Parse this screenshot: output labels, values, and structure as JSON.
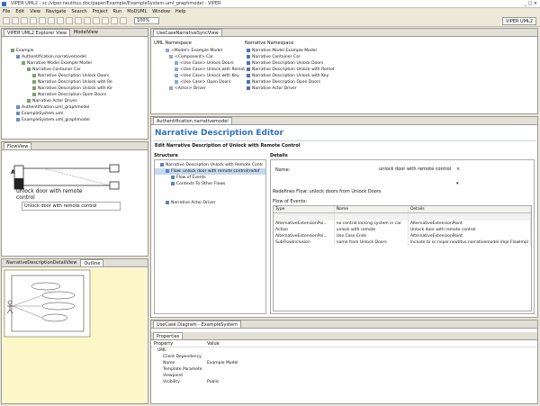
{
  "window": {
    "title": "VIPER UML2 - sc:/viper.neutitus.doc/paper/Example/ExampleSystem.uml_graphmodel - VIPER"
  },
  "menu": [
    "File",
    "Edit",
    "View",
    "Navigate",
    "Search",
    "Project",
    "Run",
    "MoDUML",
    "Window",
    "Help"
  ],
  "toolbar": {
    "zoom": "100%",
    "perspective": "VIPER UML2"
  },
  "explorer": {
    "tabs": [
      "VIPER UML2 Explorer View",
      "ModelView"
    ],
    "items": [
      {
        "label": "Example",
        "indent": 6
      },
      {
        "label": "Authentification.narrativemodel",
        "indent": 12
      },
      {
        "label": "Narrative Model Example Model",
        "indent": 18
      },
      {
        "label": "Narrative Container Car",
        "indent": 24
      },
      {
        "label": "Narrative Description Unlock Doors",
        "indent": 30
      },
      {
        "label": "Narrative Description Unlock with Re",
        "indent": 30
      },
      {
        "label": "Narrative Description Unlock with Ke",
        "indent": 30
      },
      {
        "label": "Narrative Description Open Doors",
        "indent": 30
      },
      {
        "label": "Narrative Actor Driver",
        "indent": 24
      },
      {
        "label": "Authentification.uml_graphmodel",
        "indent": 12
      },
      {
        "label": "ExampleSystem.uml",
        "indent": 12
      },
      {
        "label": "ExampleSystem.uml_graphmodel",
        "indent": 12
      }
    ]
  },
  "flowview": {
    "tab": "FlowView",
    "node_label": "A",
    "action": "unlock door with remote control",
    "note": "Unlock door with remote control"
  },
  "outline": {
    "tabs": [
      "NarrativeDescriptionDetailView",
      "Outline"
    ]
  },
  "sync": {
    "tab": "UseCaseNarrativeSyncView",
    "left_header": "UML Namespace",
    "left_items": [
      "<Model> Example Model",
      "<Component> Car",
      "<Use Case> Unlock Doors",
      "<Use Case> Unlock with Remot",
      "<Use Case> Unlock with Key",
      "<Use Case> Open Doors",
      "<Actor> Driver"
    ],
    "right_header": "Narrative Namespace",
    "right_items": [
      "Narrative Model Example Model",
      "Narrative Container Car",
      "Narrative Description Unlock Doors",
      "Narrative Description Unlock with Remot",
      "Narrative Description Unlock with Key",
      "Narrative Description Open Doors",
      "Narrative Actor Driver"
    ]
  },
  "editor": {
    "tab": "Authentification.narrativemodel",
    "title": "Narrative Description Editor",
    "subtitle": "Edit Narrative Description of Unlock with Remote Control",
    "structure_header": "Structure",
    "structure_items": [
      "Narrative Description Unlock with Remote Contr",
      "Flow: unlock door with remote control(redef",
      "Flow of Events",
      "Contexts To Other Flows",
      "",
      "",
      "Narrative Actor Driver"
    ],
    "details_header": "Details",
    "name_label": "Name:",
    "name_value": "unlock door with remote control",
    "redefines": "Redefines Flow: unlock doors from Unlock Doors",
    "flow_label": "Flow of Events:",
    "columns": [
      "Type",
      "Name",
      "Details"
    ],
    "rows": [
      [
        "AlternativeExtensionPoi...",
        "no central locking system in car",
        "AlternativeExtensionPoint"
      ],
      [
        "Action",
        "unlock with remote",
        "Unlock door with remote control"
      ],
      [
        "AlternativeExtensionPoi...",
        "Use Case Ends",
        "AlternativeExtensionPoint"
      ],
      [
        "SubFlowInclusion",
        "name from Unlock Doors",
        "Include to sc:/viper.neutitus.narrativemodel.impl.FlowImpl"
      ]
    ]
  },
  "diagram_tab": "UseCase Diagram - ExampleSystem",
  "properties": {
    "tab": "Properties",
    "header_property": "Property",
    "header_value": "Value",
    "rows": [
      {
        "property": "UML",
        "value": "",
        "indent": 4
      },
      {
        "property": "Client Dependency",
        "value": "",
        "indent": 10
      },
      {
        "property": "Name",
        "value": "Example Model",
        "indent": 10
      },
      {
        "property": "Template Paramete",
        "value": "",
        "indent": 10
      },
      {
        "property": "Viewpoint",
        "value": "",
        "indent": 10
      },
      {
        "property": "Visibility",
        "value": "Public",
        "indent": 10
      }
    ]
  },
  "colors": {
    "accent": "#2f6fbf",
    "selection": "#c7d7f0",
    "outline_bg": "#fdf7c8"
  }
}
